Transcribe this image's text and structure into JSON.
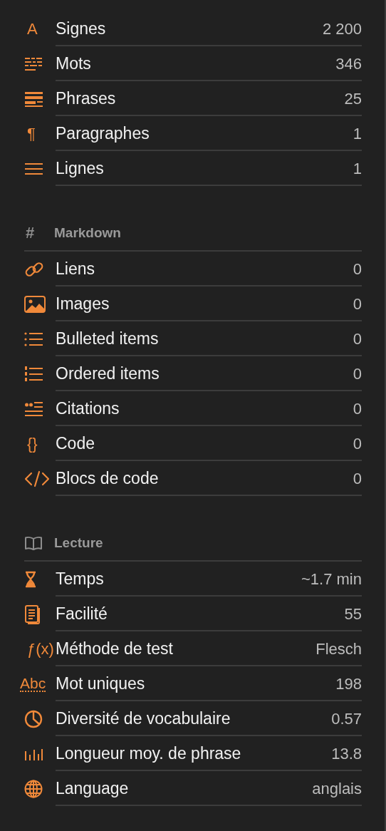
{
  "sections": [
    {
      "items": [
        {
          "glyph": "A",
          "label": "Signes",
          "value": "2 200"
        },
        {
          "label": "Mots",
          "value": "346"
        },
        {
          "label": "Phrases",
          "value": "25"
        },
        {
          "glyph": "¶",
          "label": "Paragraphes",
          "value": "1"
        },
        {
          "label": "Lignes",
          "value": "1"
        }
      ]
    },
    {
      "header": {
        "glyph": "#",
        "title": "Markdown"
      },
      "items": [
        {
          "label": "Liens",
          "value": "0"
        },
        {
          "label": "Images",
          "value": "0"
        },
        {
          "label": "Bulleted items",
          "value": "0"
        },
        {
          "label": "Ordered items",
          "value": "0"
        },
        {
          "label": "Citations",
          "value": "0"
        },
        {
          "glyph": "{}",
          "label": "Code",
          "value": "0"
        },
        {
          "label": "Blocs de code",
          "value": "0"
        }
      ]
    },
    {
      "header": {
        "title": "Lecture"
      },
      "items": [
        {
          "label": "Temps",
          "value": "~1.7 min"
        },
        {
          "label": "Facilité",
          "value": "55"
        },
        {
          "glyph": "ƒ(x)",
          "label": "Méthode de test",
          "value": "Flesch"
        },
        {
          "glyph": "Abc",
          "label": "Mot uniques",
          "value": "198"
        },
        {
          "label": "Diversité de vocabulaire",
          "value": "0.57"
        },
        {
          "label": "Longueur moy. de phrase",
          "value": "13.8"
        },
        {
          "label": "Language",
          "value": "anglais"
        }
      ]
    }
  ]
}
